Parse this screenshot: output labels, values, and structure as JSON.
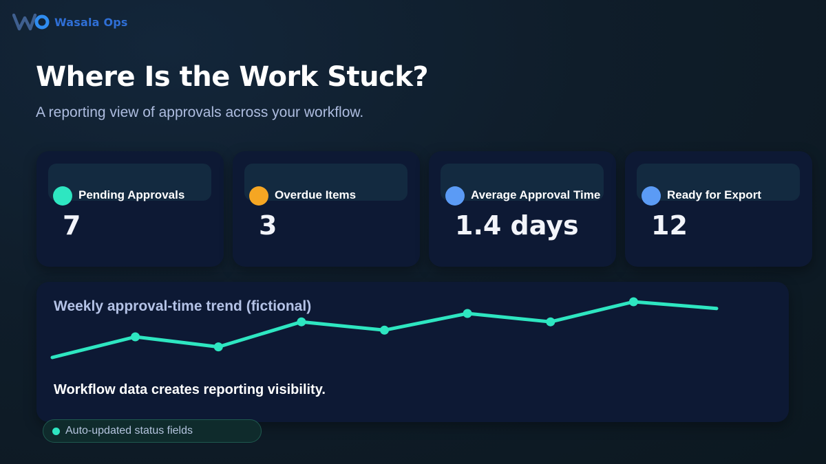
{
  "brand": {
    "name": "Wasala Ops",
    "icon": "wasala-logo-icon",
    "color": "#2f6fd6"
  },
  "header": {
    "title": "Where Is the Work Stuck?",
    "subtitle": "A reporting view of approvals across your workflow."
  },
  "kpis": [
    {
      "label": "Pending Approvals",
      "value": "7",
      "dot_color": "#2ee6c1"
    },
    {
      "label": "Overdue Items",
      "value": "3",
      "dot_color": "#f5a623"
    },
    {
      "label": "Average Approval Time",
      "value": "1.4 days",
      "dot_color": "#5b9bf5"
    },
    {
      "label": "Ready for Export",
      "value": "12",
      "dot_color": "#5b9bf5"
    }
  ],
  "trend": {
    "title": "Weekly approval-time trend (fictional)",
    "caption": "Workflow data creates reporting visibility.",
    "line_color": "#2ee6c1"
  },
  "chart_data": {
    "type": "line",
    "title": "Weekly approval-time trend (fictional)",
    "series": [
      {
        "values": [
          0.0,
          0.37,
          0.19,
          0.64,
          0.49,
          0.79,
          0.64,
          1.0,
          0.88
        ]
      }
    ],
    "markers": [
      false,
      true,
      true,
      true,
      true,
      true,
      true,
      true,
      false
    ],
    "ylim": [
      0,
      1
    ],
    "grid": false,
    "axes_visible": false
  },
  "status_pill": {
    "label": "Auto-updated status fields",
    "dot_color": "#2ee6c1"
  }
}
